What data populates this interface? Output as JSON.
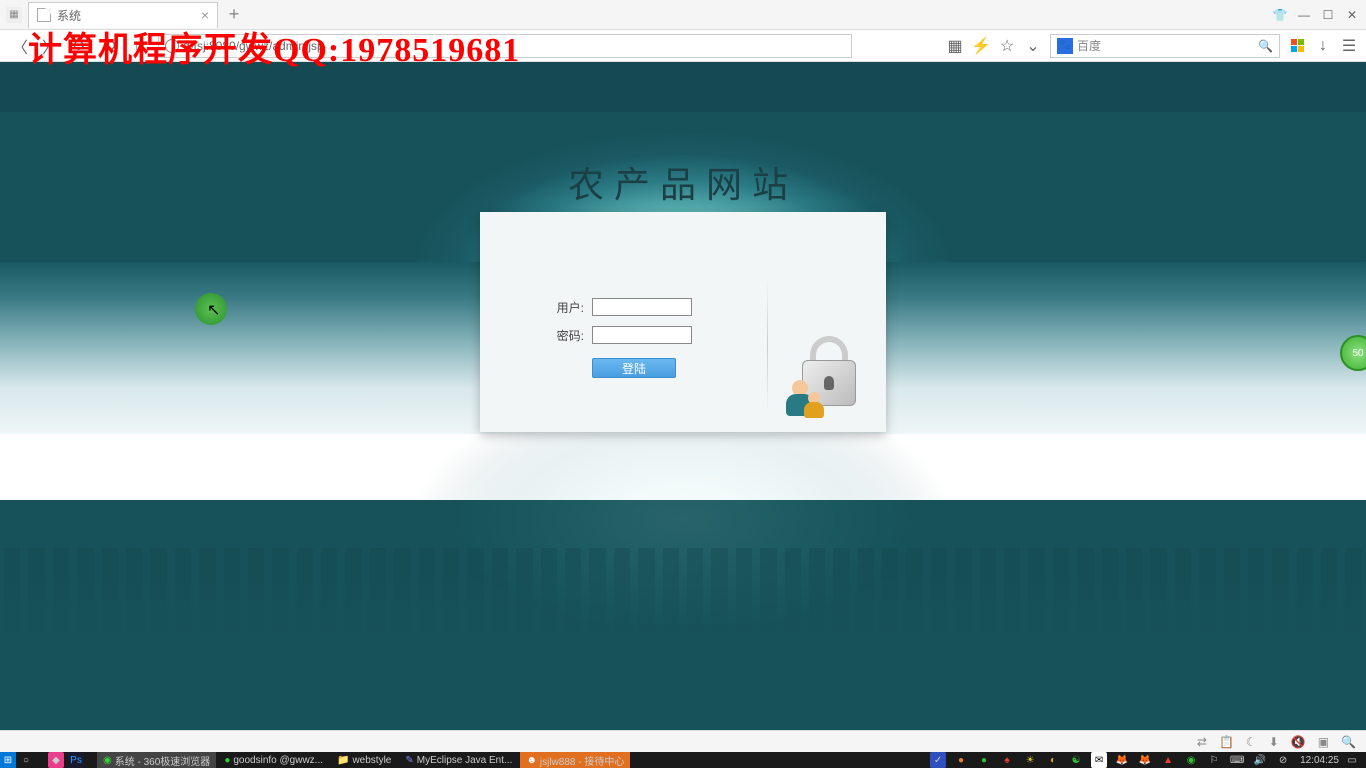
{
  "browser": {
    "tab_title": "系统",
    "url": "q-tsj:8080/gwwz/admin.jsp",
    "search_engine": "百度",
    "window_controls": {
      "skin": "👕",
      "min": "—",
      "max": "☐",
      "close": "✕"
    }
  },
  "watermark": "计算机程序开发QQ:1978519681",
  "login": {
    "site_title": "农产品网站",
    "user_label": "用户:",
    "pwd_label": "密码:",
    "user_value": "",
    "pwd_value": "",
    "submit_label": "登陆"
  },
  "float_badge": "50",
  "taskbar": {
    "items": [
      {
        "label": "系统 - 360极速浏览器",
        "active": true,
        "color": "#30d030"
      },
      {
        "label": "goodsinfo @gwwz...",
        "color": "#30d030"
      },
      {
        "label": "webstyle",
        "color": "#f0c040"
      },
      {
        "label": "MyEclipse Java Ent...",
        "color": "#8080ff"
      },
      {
        "label": "jsjlw888 - 接待中心",
        "orange": true,
        "color": "#fff"
      }
    ],
    "clock": "12:04:25"
  }
}
